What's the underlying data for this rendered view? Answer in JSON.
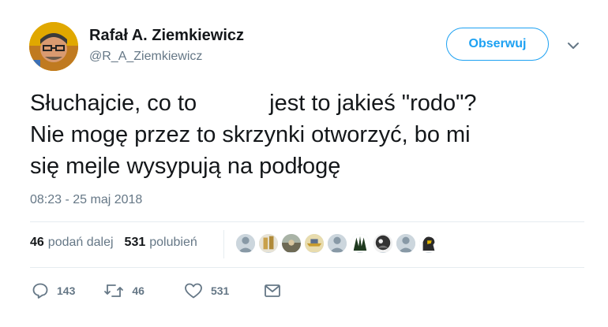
{
  "user": {
    "display_name": "Rafał A. Ziemkiewicz",
    "handle": "@R_A_Ziemkiewicz"
  },
  "follow_button": {
    "label": "Obserwuj"
  },
  "tweet": {
    "text_line1_a": "Słuchajcie, co to",
    "text_line1_b": "jest to jakieś \"rodo\"?",
    "text_line2": "Nie mogę przez to skrzynki otworzyć, bo mi",
    "text_line3": "się mejle wysypują na podłogę",
    "timestamp": "08:23 - 25 maj 2018"
  },
  "stats": {
    "retweets_count": "46",
    "retweets_label": "podań dalej",
    "likes_count": "531",
    "likes_label": "polubień"
  },
  "actions": {
    "reply_count": "143",
    "retweet_count": "46",
    "like_count": "531"
  },
  "colors": {
    "accent": "#1da1f2",
    "muted": "#657786",
    "text": "#14171a",
    "divider": "#e6ecf0"
  }
}
